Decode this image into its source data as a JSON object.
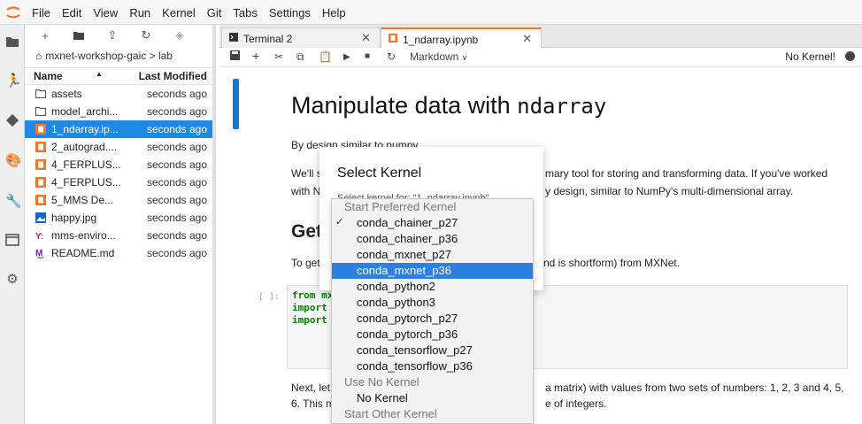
{
  "menubar": {
    "items": [
      "File",
      "Edit",
      "View",
      "Run",
      "Kernel",
      "Git",
      "Tabs",
      "Settings",
      "Help"
    ]
  },
  "filebrowser": {
    "breadcrumb": "mxnet-workshop-gaic > lab",
    "header": {
      "name": "Name",
      "modified": "Last Modified"
    },
    "files": [
      {
        "name": "assets",
        "modified": "seconds ago",
        "icon": "folder-icon"
      },
      {
        "name": "model_archi...",
        "modified": "seconds ago",
        "icon": "folder-icon"
      },
      {
        "name": "1_ndarray.ip...",
        "modified": "seconds ago",
        "icon": "notebook-icon",
        "selected": true
      },
      {
        "name": "2_autograd....",
        "modified": "seconds ago",
        "icon": "notebook-icon"
      },
      {
        "name": "4_FERPLUS...",
        "modified": "seconds ago",
        "icon": "notebook-icon"
      },
      {
        "name": "4_FERPLUS...",
        "modified": "seconds ago",
        "icon": "notebook-icon"
      },
      {
        "name": "5_MMS De...",
        "modified": "seconds ago",
        "icon": "notebook-icon"
      },
      {
        "name": "happy.jpg",
        "modified": "seconds ago",
        "icon": "image-icon"
      },
      {
        "name": "mms-enviro...",
        "modified": "seconds ago",
        "icon": "yaml-icon"
      },
      {
        "name": "README.md",
        "modified": "seconds ago",
        "icon": "markdown-icon"
      }
    ]
  },
  "tabs": [
    {
      "label": "Terminal 2",
      "icon": "terminal-icon"
    },
    {
      "label": "1_ndarray.ipynb",
      "icon": "notebook-icon",
      "active": true
    }
  ],
  "nbtoolbar": {
    "cell_type": "Markdown",
    "kernel_status": "No Kernel!"
  },
  "notebook": {
    "title_text": "Manipulate data with ",
    "title_code": "ndarray",
    "p1": "By design similar to numpy.",
    "p2_left": "We'll s",
    "p2_right": "mary tool for storing and transforming data. If you've worked",
    "p3_left": "with  N",
    "p3_right": "y design, similar to NumPy's multi-dimensional array.",
    "h2": "Get",
    "p4_left": "To get",
    "p4_right": "nd  is shortform) from MXNet.",
    "prompt": "[ ]:",
    "code": [
      "from mx",
      "import",
      "import"
    ],
    "p5_left": "Next, let",
    "p5_right": "a matrix) with values from two sets of numbers: 1, 2, 3 and 4, 5,",
    "p6_left": "6. This m",
    "p6_right": "e of integers."
  },
  "dialog": {
    "title": "Select Kernel",
    "label": "Select kernel for: \"1_ndarray.ipynb\"",
    "options": [
      {
        "text": "Start Preferred Kernel",
        "group": true
      },
      {
        "text": "conda_chainer_p27",
        "checked": true
      },
      {
        "text": "conda_chainer_p36"
      },
      {
        "text": "conda_mxnet_p27"
      },
      {
        "text": "conda_mxnet_p36",
        "highlighted": true
      },
      {
        "text": "conda_python2"
      },
      {
        "text": "conda_python3"
      },
      {
        "text": "conda_pytorch_p27"
      },
      {
        "text": "conda_pytorch_p36"
      },
      {
        "text": "conda_tensorflow_p27"
      },
      {
        "text": "conda_tensorflow_p36"
      },
      {
        "text": "Use No Kernel",
        "group": true
      },
      {
        "text": "No Kernel"
      },
      {
        "text": "Start Other Kernel",
        "group": true
      }
    ],
    "check_mark": "✓"
  },
  "colors": {
    "accent": "#f37626",
    "selection": "#1e88e5",
    "highlight": "#2f7fe0"
  }
}
